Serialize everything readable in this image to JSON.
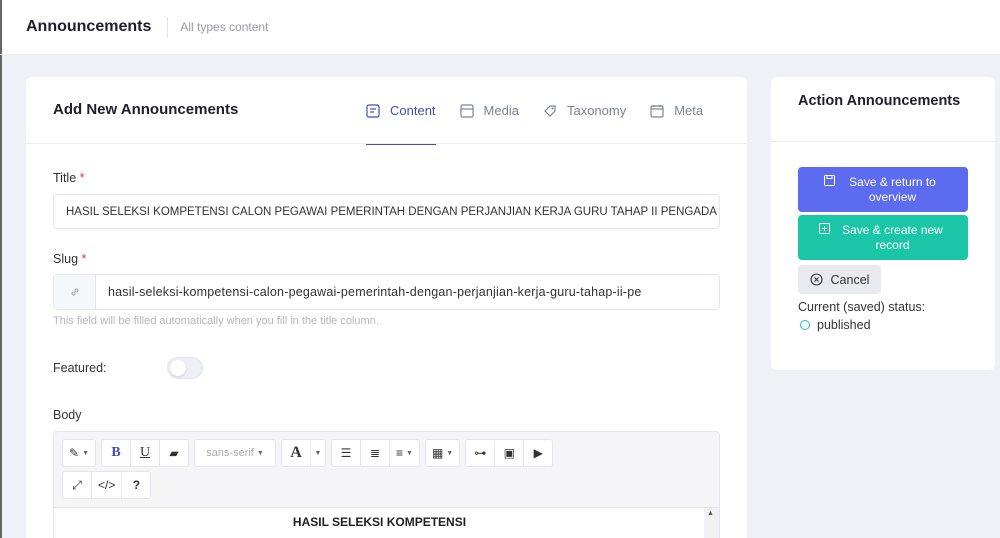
{
  "header": {
    "title": "Announcements",
    "subtitle": "All types content"
  },
  "form": {
    "heading": "Add New Announcements",
    "tabs": [
      {
        "label": "Content",
        "icon": "content-icon",
        "active": true
      },
      {
        "label": "Media",
        "icon": "media-icon",
        "active": false
      },
      {
        "label": "Taxonomy",
        "icon": "taxonomy-icon",
        "active": false
      },
      {
        "label": "Meta",
        "icon": "meta-icon",
        "active": false
      }
    ],
    "title_label": "Title",
    "title_value": "HASIL SELEKSI KOMPETENSI CALON PEGAWAI PEMERINTAH DENGAN PERJANJIAN KERJA GURU TAHAP II PENGADA",
    "slug_label": "Slug",
    "slug_value": "hasil-seleksi-kompetensi-calon-pegawai-pemerintah-dengan-perjanjian-kerja-guru-tahap-ii-pe",
    "slug_hint": "This field will be filled automatically when you fill in the title column.",
    "required_mark": "*",
    "featured_label": "Featured:",
    "featured_on": false,
    "body_label": "Body",
    "editor": {
      "font": "sans-serif",
      "content_heading": "HASIL SELEKSI KOMPETENSI"
    }
  },
  "sidebar": {
    "heading": "Action Announcements",
    "save_return_label": "Save & return to overview",
    "save_create_label": "Save & create new record",
    "cancel_label": "Cancel",
    "status_label": "Current (saved) status:",
    "status_value": "published"
  },
  "colors": {
    "primary": "#5c6bf0",
    "success": "#1bc5a8",
    "accent": "#3f51b5"
  }
}
